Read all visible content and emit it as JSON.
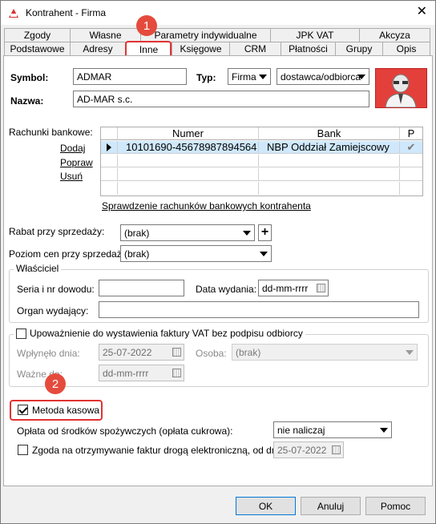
{
  "window": {
    "title": "Kontrahent - Firma"
  },
  "tabs_row1": [
    "Zgody",
    "Własne",
    "Parametry indywidualne",
    "JPK VAT",
    "Akcyza"
  ],
  "tabs_row2": [
    "Podstawowe",
    "Adresy",
    "Inne",
    "Księgowe",
    "CRM",
    "Płatności",
    "Grupy",
    "Opis"
  ],
  "active_tab": "Inne",
  "form": {
    "symbol_label": "Symbol:",
    "symbol_value": "ADMAR",
    "typ_label": "Typ:",
    "typ_value": "Firma",
    "rodzaj_value": "dostawca/odbiorca",
    "nazwa_label": "Nazwa:",
    "nazwa_value": "AD-MAR s.c."
  },
  "bank": {
    "label": "Rachunki bankowe:",
    "actions": [
      "Dodaj",
      "Popraw",
      "Usuń"
    ],
    "columns": [
      "Numer",
      "Bank",
      "P"
    ],
    "rows": [
      {
        "numer": "10101690-45678987894564",
        "bank": "NBP Oddział Zamiejscowy",
        "p": "✔"
      }
    ],
    "check_link": "Sprawdzenie rachunków bankowych kontrahenta"
  },
  "rabat": {
    "label": "Rabat przy sprzedaży:",
    "value": "(brak)",
    "add": "+"
  },
  "poziom": {
    "label": "Poziom cen przy sprzedaży:",
    "value": "(brak)"
  },
  "wlasciciel": {
    "title": "Właściciel",
    "seria_label": "Seria i nr dowodu:",
    "seria_value": "",
    "data_label": "Data wydania:",
    "data_value": "dd-mm-rrrr",
    "organ_label": "Organ wydający:",
    "organ_value": ""
  },
  "upowaznienie": {
    "title": "Upoważnienie do wystawienia faktury VAT bez podpisu odbiorcy",
    "wplynelo_label": "Wpłynęło dnia:",
    "wplynelo_value": "25-07-2022",
    "osoba_label": "Osoba:",
    "osoba_value": "(brak)",
    "wazne_label": "Ważne do:",
    "wazne_value": "dd-mm-rrrr"
  },
  "metoda": {
    "label": "Metoda kasowa",
    "checked": true
  },
  "oplata": {
    "label": "Opłata od środków spożywczych (opłata cukrowa):",
    "value": "nie naliczaj"
  },
  "zgoda": {
    "label": "Zgoda na otrzymywanie faktur drogą elektroniczną, od dnia:",
    "value": "25-07-2022"
  },
  "buttons": {
    "ok": "OK",
    "cancel": "Anuluj",
    "help": "Pomoc"
  },
  "annotations": [
    "1",
    "2"
  ],
  "colors": {
    "accent": "#0078d7",
    "highlight": "#e23232",
    "badge": "#e44b3c"
  }
}
